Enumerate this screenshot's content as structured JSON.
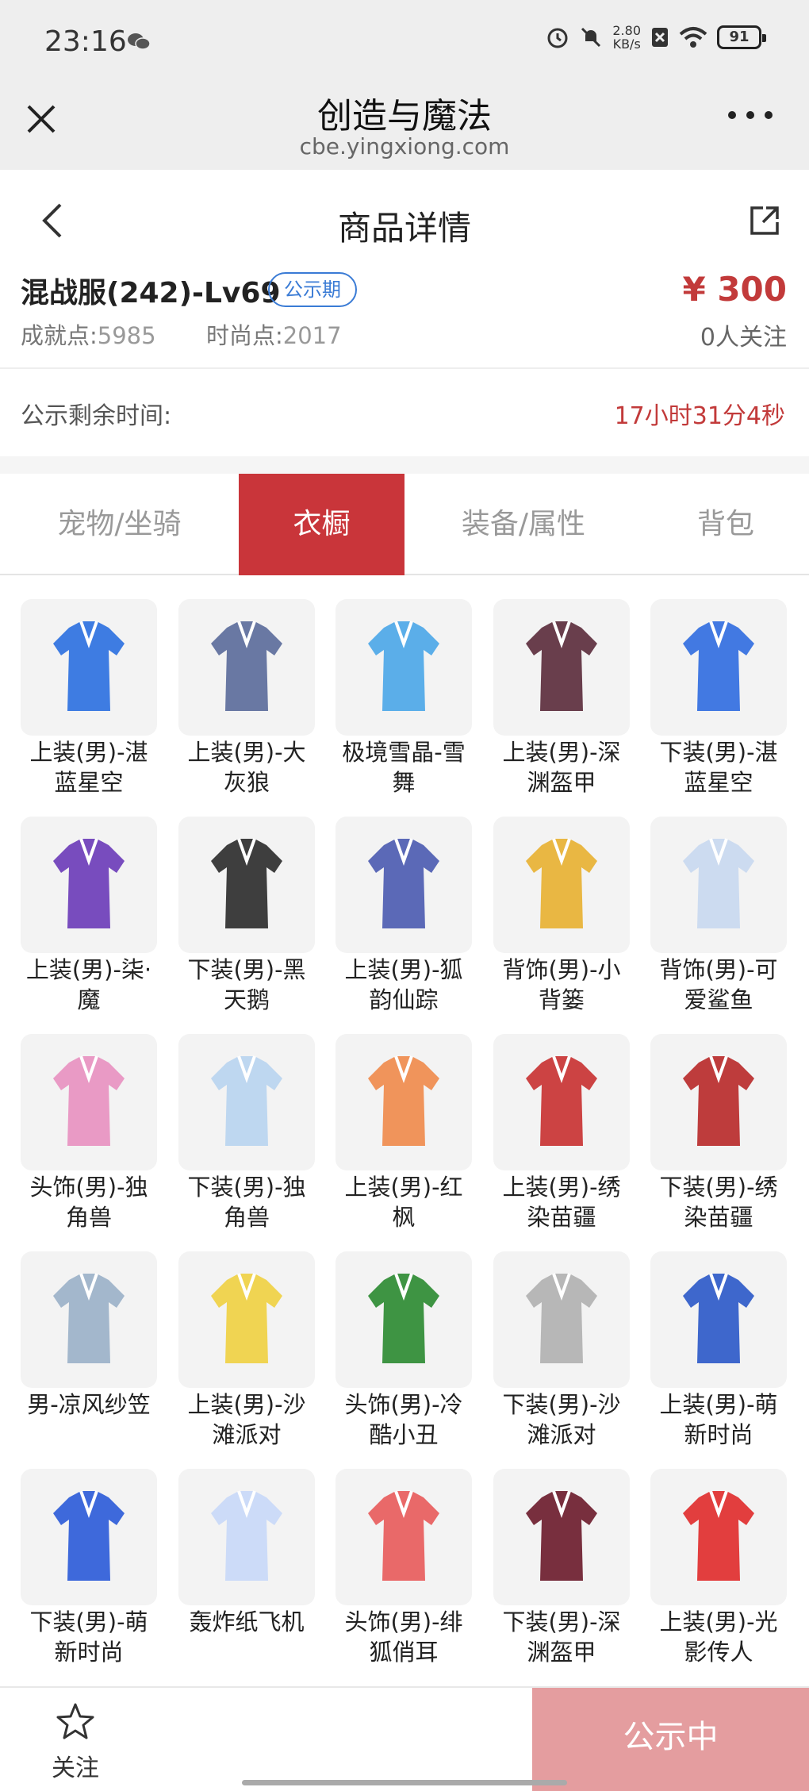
{
  "status_bar": {
    "time": "23:16",
    "speed_value": "2.80",
    "speed_unit": "KB/s",
    "battery": "91"
  },
  "browser": {
    "title": "创造与魔法",
    "url": "cbe.yingxiong.com"
  },
  "nav": {
    "title": "商品详情"
  },
  "item": {
    "name": "混战服(242)-Lv69",
    "badge": "公示期",
    "achievement_label": "成就点:",
    "achievement_value": "5985",
    "fashion_label": "时尚点:",
    "fashion_value": "2017",
    "price": "¥ 300",
    "followers": "0人关注"
  },
  "countdown": {
    "label": "公示剩余时间:",
    "value": "17小时31分4秒"
  },
  "tabs": [
    {
      "label": "宠物/坐骑"
    },
    {
      "label": "衣橱"
    },
    {
      "label": "装备/属性"
    },
    {
      "label": "背包"
    }
  ],
  "active_tab": 1,
  "wardrobe": [
    {
      "label": "上装(男)-湛蓝星空",
      "icon": "blue-star-jacket",
      "color": "#2a6fe0"
    },
    {
      "label": "上装(男)-大灰狼",
      "icon": "grey-wolf-top",
      "color": "#5a6a9a"
    },
    {
      "label": "极境雪晶-雪舞",
      "icon": "snow-crystal-weapon",
      "color": "#4aa6e8"
    },
    {
      "label": "上装(男)-深渊盔甲",
      "icon": "abyss-armor",
      "color": "#5a2a3a"
    },
    {
      "label": "下装(男)-湛蓝星空",
      "icon": "blue-star-pants",
      "color": "#2f6ce0"
    },
    {
      "label": "上装(男)-柒·魔",
      "icon": "purple-demon-coat",
      "color": "#6a3ab8"
    },
    {
      "label": "下装(男)-黑天鹅",
      "icon": "black-swan-boots",
      "color": "#2a2a2a"
    },
    {
      "label": "上装(男)-狐韵仙踪",
      "icon": "fox-robe",
      "color": "#4a5ab0"
    },
    {
      "label": "背饰(男)-小背篓",
      "icon": "flower-basket",
      "color": "#e8b030"
    },
    {
      "label": "背饰(男)-可爱鲨鱼",
      "icon": "cute-shark",
      "color": "#c8d8f0"
    },
    {
      "label": "头饰(男)-独角兽",
      "icon": "unicorn-hood",
      "color": "#e890c0"
    },
    {
      "label": "下装(男)-独角兽",
      "icon": "unicorn-shoes",
      "color": "#b8d4f0"
    },
    {
      "label": "上装(男)-红枫",
      "icon": "red-maple-robe",
      "color": "#f08a4a"
    },
    {
      "label": "上装(男)-绣染苗疆",
      "icon": "miao-embroidered-top",
      "color": "#c83030"
    },
    {
      "label": "下装(男)-绣染苗疆",
      "icon": "miao-embroidered-skirt",
      "color": "#b82828"
    },
    {
      "label": "男-凉风纱笠",
      "icon": "veil-hat",
      "color": "#9ab0c8"
    },
    {
      "label": "上装(男)-沙滩派对",
      "icon": "beach-party-top",
      "color": "#f0d040"
    },
    {
      "label": "头饰(男)-冷酷小丑",
      "icon": "joker-mask",
      "color": "#2a8a30"
    },
    {
      "label": "下装(男)-沙滩派对",
      "icon": "beach-party-legs",
      "color": "#b0b0b0"
    },
    {
      "label": "上装(男)-萌新时尚",
      "icon": "newbie-fashion-top",
      "color": "#2a58c8"
    },
    {
      "label": "下装(男)-萌新时尚",
      "icon": "newbie-fashion-pants",
      "color": "#2a5ad8"
    },
    {
      "label": "轰炸纸飞机",
      "icon": "paper-plane",
      "color": "#c8d8f8"
    },
    {
      "label": "头饰(男)-绯狐俏耳",
      "icon": "fox-ears",
      "color": "#e85a5a"
    },
    {
      "label": "下装(男)-深渊盔甲",
      "icon": "abyss-armor-legs",
      "color": "#6a1a2a"
    },
    {
      "label": "上装(男)-光影传人",
      "icon": "red-hoodie",
      "color": "#e02a2a"
    }
  ],
  "bottom": {
    "follow_label": "关注",
    "action_label": "公示中"
  },
  "colors": {
    "accent": "#c9353a",
    "price": "#c23a3a",
    "badge": "#3a7bd5",
    "action_disabled": "#e49d9f"
  }
}
